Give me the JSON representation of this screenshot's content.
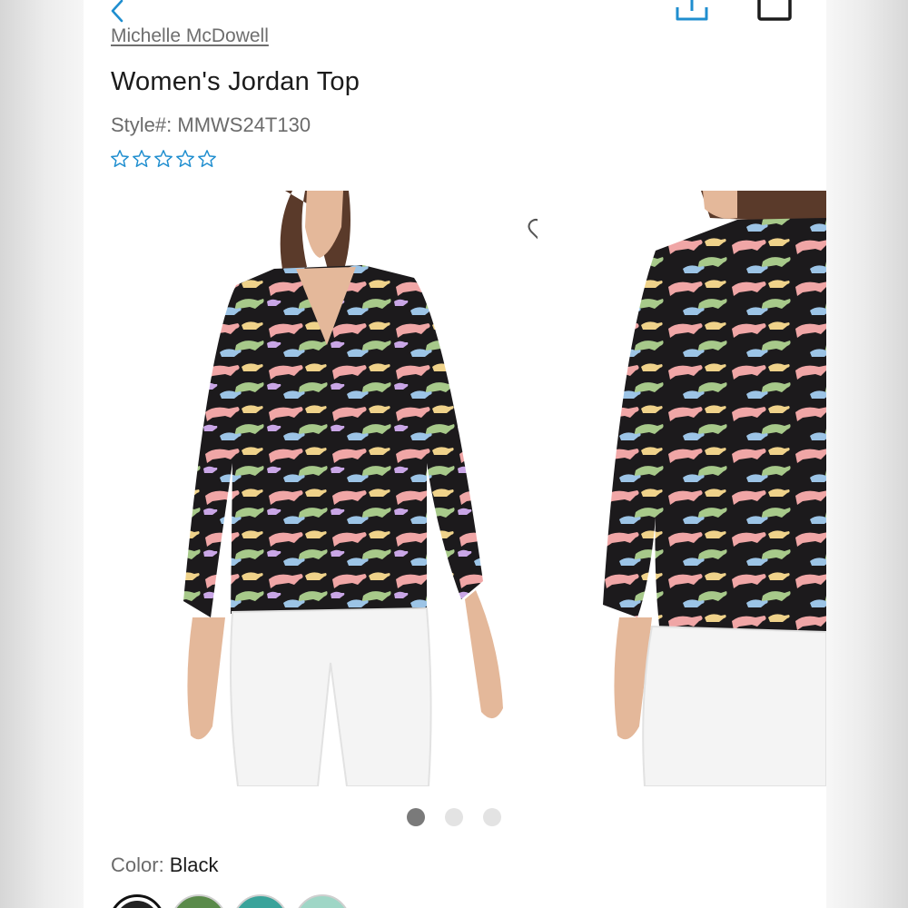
{
  "header": {
    "back_icon": "chevron-left-icon",
    "share_icon": "share-upload-icon",
    "cart_icon": "shopping-bag-icon"
  },
  "product": {
    "brand": "Michelle McDowell",
    "title": "Women's Jordan Top",
    "style_number": "Style#: MMWS24T130",
    "rating": 0,
    "rating_max": 5
  },
  "gallery": {
    "images": [
      {
        "name": "front view photo of black cheetah print top"
      },
      {
        "name": "back view photo of black cheetah print top"
      }
    ],
    "page_count": 3,
    "active_page": 1
  },
  "color": {
    "label": "Color:",
    "selected": "Black",
    "swatches": [
      {
        "name": "black",
        "hex": "#222222",
        "selected": true
      },
      {
        "name": "green",
        "hex": "#5a8a4a",
        "selected": false
      },
      {
        "name": "teal",
        "hex": "#3aa39a",
        "selected": false
      },
      {
        "name": "mint",
        "hex": "#9fd6c6",
        "selected": false
      }
    ]
  },
  "colors": {
    "accent": "#1f8ecf",
    "text_primary": "#1b1b1b",
    "text_secondary": "#6b6b6b"
  }
}
